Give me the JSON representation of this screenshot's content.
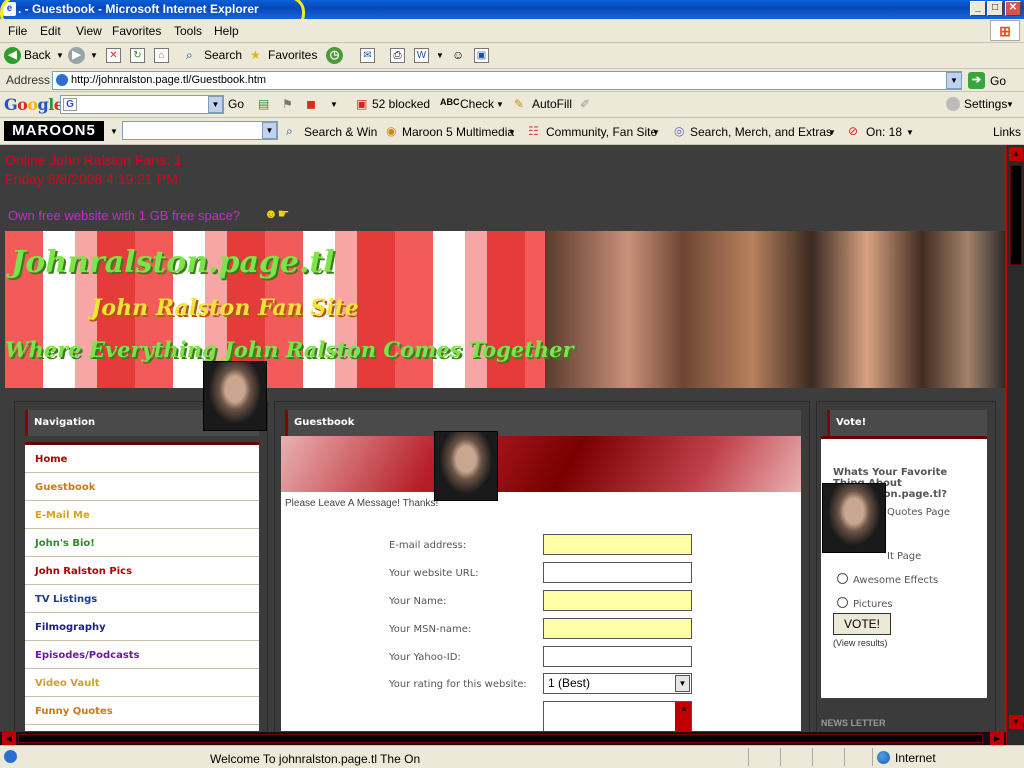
{
  "window": {
    "title": ". - Guestbook - Microsoft Internet Explorer",
    "min": "_",
    "max": "□",
    "close": "✕"
  },
  "menu": [
    "File",
    "Edit",
    "View",
    "Favorites",
    "Tools",
    "Help"
  ],
  "toolbar": {
    "back": "Back",
    "search": "Search",
    "favorites": "Favorites"
  },
  "address": {
    "label": "Address",
    "url": "http://johnralston.page.tl/Guestbook.htm",
    "go": "Go"
  },
  "googlebar": {
    "logo": "Google",
    "go": "Go",
    "blocked": "52 blocked",
    "check": "Check",
    "autofill": "AutoFill",
    "settings": "Settings"
  },
  "m5bar": {
    "logo": "MAROON5",
    "search_win": "Search & Win",
    "multimedia": "Maroon 5 Multimedia",
    "community": "Community, Fan Site",
    "merch": "Search, Merch, and Extras",
    "on": "On: 18",
    "links": "Links"
  },
  "page": {
    "fans": "Online John Ralston Fans: 1",
    "date": "Friday 8/8/2008 4:19:21 PM",
    "promo": "Own free website with 1 GB free space?",
    "banner": {
      "t1": "Johnralston.page.tl",
      "t2": "John Ralston Fan Site",
      "t3": "Where Everything John Ralston Comes Together"
    },
    "nav": {
      "title": "Navigation",
      "items": [
        {
          "label": "Home",
          "color": "#B00000"
        },
        {
          "label": "Guestbook",
          "color": "#C87A1E"
        },
        {
          "label": "E-Mail Me",
          "color": "#D9A21C"
        },
        {
          "label": "John's Bio!",
          "color": "#2E8B2E"
        },
        {
          "label": "John Ralston Pics",
          "color": "#B00000"
        },
        {
          "label": "TV Listings",
          "color": "#1E3C8C"
        },
        {
          "label": "Filmography",
          "color": "#1A237E"
        },
        {
          "label": "Episodes/Podcasts",
          "color": "#6A1B9A"
        },
        {
          "label": "Video Vault",
          "color": "#C9A227"
        },
        {
          "label": "Funny Quotes",
          "color": "#C87A1E"
        }
      ]
    },
    "guestbook": {
      "title": "Guestbook",
      "message": "Please Leave A Message! Thanks!",
      "fields": {
        "email": "E-mail address:",
        "website": "Your website URL:",
        "name": "Your Name:",
        "msn": "Your MSN-name:",
        "yahoo": "Your Yahoo-ID:",
        "rating": "Your rating for this website:"
      },
      "rating_value": "1 (Best)"
    },
    "vote": {
      "title": "Vote!",
      "question": "Whats Your Favorite Thing About Johnralston.page.tl?",
      "option1": "Quotes Page",
      "option2": "It Page",
      "option3": "Awesome Effects",
      "option4": "Pictures",
      "button": "VOTE!",
      "results": "(View results)",
      "next": "NEWS LETTER"
    }
  },
  "status": {
    "text": "Welcome To johnralston.page.tl  The On",
    "zone": "Internet"
  }
}
